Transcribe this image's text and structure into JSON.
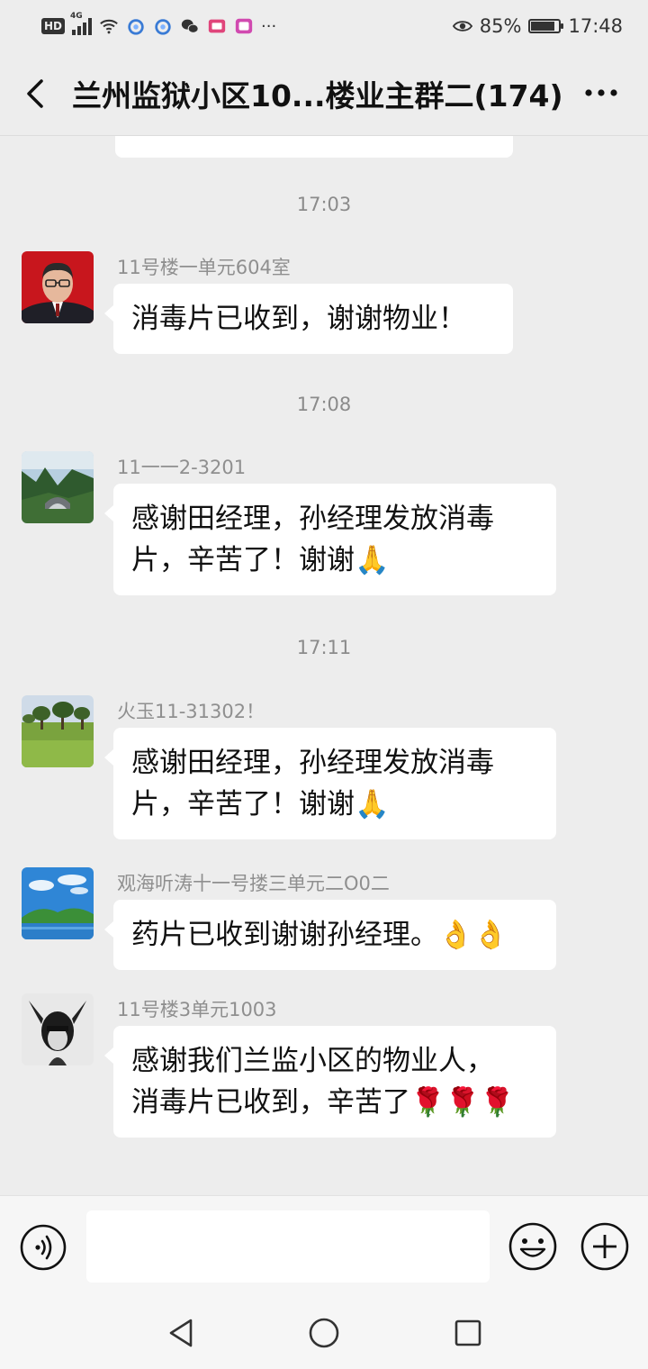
{
  "status_bar": {
    "hd_badge": "HD",
    "network": "4G",
    "battery_percent": "85%",
    "battery_level": 0.85,
    "time": "17:48",
    "overflow": "···",
    "icons": [
      "hd-icon",
      "signal-icon",
      "wifi-icon",
      "app-notification-icon",
      "app-notification-icon",
      "wechat-icon",
      "tv-app-icon",
      "camera-app-icon",
      "eye-icon",
      "battery-icon"
    ]
  },
  "header": {
    "title": "兰州监狱小区10...楼业主群二(174)",
    "back_icon": "chevron-left-icon",
    "more_icon": "more-dots-icon"
  },
  "messages": [
    {
      "type": "time",
      "text": "17:03"
    },
    {
      "type": "msg",
      "sender": "11号楼一单元604室",
      "avatar": "man-in-suit-photo",
      "lines": [
        "消毒片已收到，谢谢物业！"
      ]
    },
    {
      "type": "time",
      "text": "17:08"
    },
    {
      "type": "msg",
      "sender": "11一一2-3201",
      "avatar": "mountain-landscape-photo",
      "lines": [
        "感谢田经理，孙经理发放消毒",
        "片，辛苦了！谢谢🙏"
      ]
    },
    {
      "type": "time",
      "text": "17:11"
    },
    {
      "type": "msg",
      "sender": "火玉11-31302！",
      "avatar": "green-field-trees-photo",
      "lines": [
        "感谢田经理，孙经理发放消毒",
        "片，辛苦了！谢谢🙏"
      ]
    },
    {
      "type": "msg",
      "sender": "观海听涛十一号搂三单元二O0二",
      "avatar": "lake-blue-sky-photo",
      "lines": [
        "药片已收到谢谢孙经理。👌👌"
      ]
    },
    {
      "type": "msg",
      "sender": "11号楼3单元1003",
      "avatar": "horned-figure-artwork",
      "lines": [
        "感谢我们兰监小区的物业人，",
        "消毒片已收到，辛苦了🌹🌹🌹"
      ]
    }
  ],
  "input_bar": {
    "voice_icon": "voice-input-icon",
    "text_value": "",
    "emoji_icon": "emoji-icon",
    "plus_icon": "plus-icon"
  },
  "nav_bar": {
    "back": "nav-back-triangle-icon",
    "home": "nav-home-circle-icon",
    "recent": "nav-recent-square-icon"
  },
  "colors": {
    "background": "#ededed",
    "bubble": "#ffffff",
    "time_text": "#8b8b8b",
    "sender_text": "#8f8f8f"
  }
}
